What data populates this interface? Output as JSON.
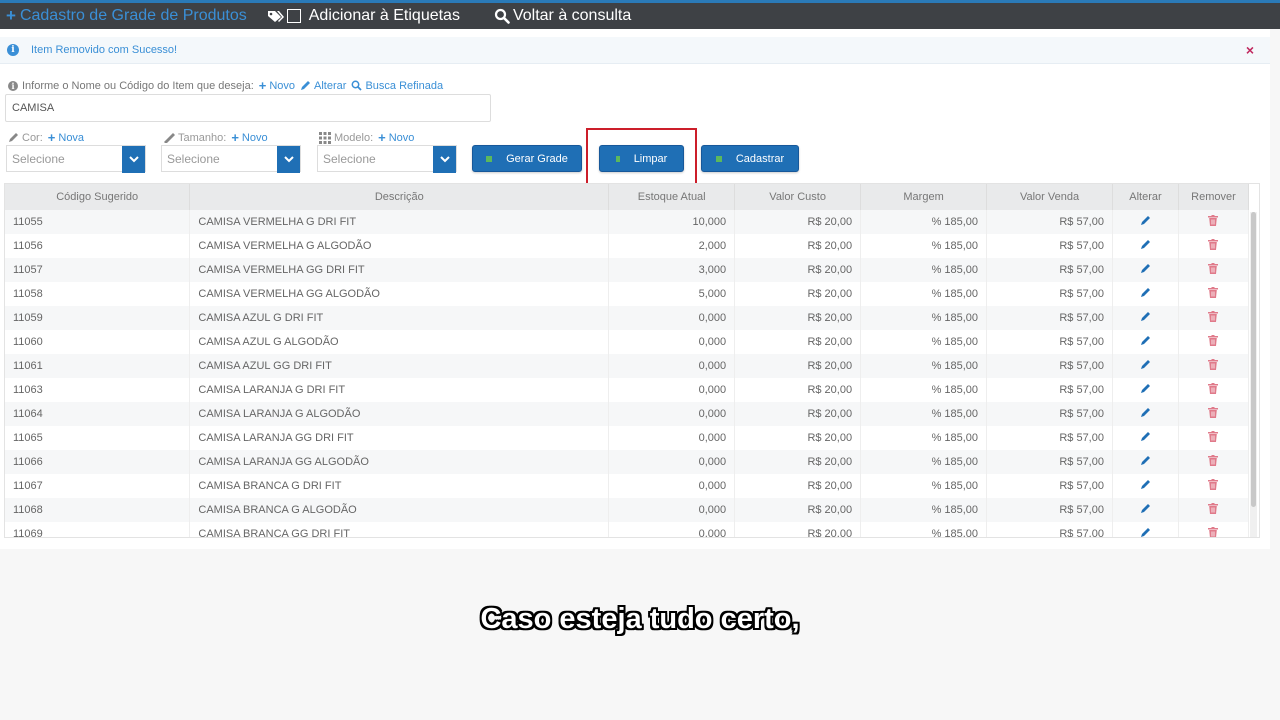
{
  "topbar": {
    "title": "Cadastro de Grade de Produtos",
    "add_labels": "Adicionar à Etiquetas",
    "back": "Voltar à consulta"
  },
  "alert": {
    "message": "Item Removido com Sucesso!",
    "close": "×"
  },
  "search": {
    "label": "Informe o Nome ou Código do Item que deseja:",
    "new": "Novo",
    "edit": "Alterar",
    "refined": "Busca Refinada",
    "value": "CAMISA"
  },
  "filters": {
    "cor": {
      "label": "Cor:",
      "new": "Nova",
      "placeholder": "Selecione"
    },
    "tamanho": {
      "label": "Tamanho:",
      "new": "Novo",
      "placeholder": "Selecione"
    },
    "modelo": {
      "label": "Modelo:",
      "new": "Novo",
      "placeholder": "Selecione"
    }
  },
  "buttons": {
    "generate": "Gerar Grade",
    "clear": "Limpar",
    "register": "Cadastrar"
  },
  "table": {
    "headers": [
      "Código Sugerido",
      "Descrição",
      "Estoque Atual",
      "Valor Custo",
      "Margem",
      "Valor Venda",
      "Alterar",
      "Remover"
    ],
    "rows": [
      {
        "code": "11055",
        "desc": "CAMISA VERMELHA G DRI FIT",
        "stock": "10,000",
        "cost": "R$ 20,00",
        "margin": "% 185,00",
        "price": "R$ 57,00"
      },
      {
        "code": "11056",
        "desc": "CAMISA VERMELHA G ALGODÃO",
        "stock": "2,000",
        "cost": "R$ 20,00",
        "margin": "% 185,00",
        "price": "R$ 57,00"
      },
      {
        "code": "11057",
        "desc": "CAMISA VERMELHA GG DRI FIT",
        "stock": "3,000",
        "cost": "R$ 20,00",
        "margin": "% 185,00",
        "price": "R$ 57,00"
      },
      {
        "code": "11058",
        "desc": "CAMISA VERMELHA GG ALGODÃO",
        "stock": "5,000",
        "cost": "R$ 20,00",
        "margin": "% 185,00",
        "price": "R$ 57,00"
      },
      {
        "code": "11059",
        "desc": "CAMISA AZUL G DRI FIT",
        "stock": "0,000",
        "cost": "R$ 20,00",
        "margin": "% 185,00",
        "price": "R$ 57,00"
      },
      {
        "code": "11060",
        "desc": "CAMISA AZUL G ALGODÃO",
        "stock": "0,000",
        "cost": "R$ 20,00",
        "margin": "% 185,00",
        "price": "R$ 57,00"
      },
      {
        "code": "11061",
        "desc": "CAMISA AZUL GG DRI FIT",
        "stock": "0,000",
        "cost": "R$ 20,00",
        "margin": "% 185,00",
        "price": "R$ 57,00"
      },
      {
        "code": "11063",
        "desc": "CAMISA LARANJA G DRI FIT",
        "stock": "0,000",
        "cost": "R$ 20,00",
        "margin": "% 185,00",
        "price": "R$ 57,00"
      },
      {
        "code": "11064",
        "desc": "CAMISA LARANJA G ALGODÃO",
        "stock": "0,000",
        "cost": "R$ 20,00",
        "margin": "% 185,00",
        "price": "R$ 57,00"
      },
      {
        "code": "11065",
        "desc": "CAMISA LARANJA GG DRI FIT",
        "stock": "0,000",
        "cost": "R$ 20,00",
        "margin": "% 185,00",
        "price": "R$ 57,00"
      },
      {
        "code": "11066",
        "desc": "CAMISA LARANJA GG ALGODÃO",
        "stock": "0,000",
        "cost": "R$ 20,00",
        "margin": "% 185,00",
        "price": "R$ 57,00"
      },
      {
        "code": "11067",
        "desc": "CAMISA BRANCA G DRI FIT",
        "stock": "0,000",
        "cost": "R$ 20,00",
        "margin": "% 185,00",
        "price": "R$ 57,00"
      },
      {
        "code": "11068",
        "desc": "CAMISA BRANCA G ALGODÃO",
        "stock": "0,000",
        "cost": "R$ 20,00",
        "margin": "% 185,00",
        "price": "R$ 57,00"
      },
      {
        "code": "11069",
        "desc": "CAMISA BRANCA GG DRI FIT",
        "stock": "0,000",
        "cost": "R$ 20,00",
        "margin": "% 185,00",
        "price": "R$ 57,00"
      }
    ]
  },
  "subtitle": "Caso esteja tudo certo,",
  "colors": {
    "accent": "#1f6fb5",
    "link": "#3a8fd6",
    "highlight": "#cc1e2a",
    "delete": "#e07a8a"
  }
}
